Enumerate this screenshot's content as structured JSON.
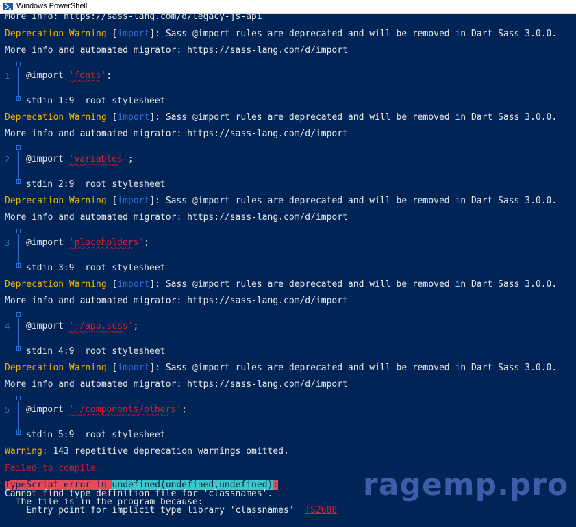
{
  "window": {
    "title": "Windows PowerShell"
  },
  "colors": {
    "background": "#012456",
    "warning": "#eeb200",
    "category": "#2b6fd6",
    "string": "#d91f2e",
    "error_bg": "#e64a5a",
    "undefined_bg": "#3fc6c6"
  },
  "console": {
    "line_more_info_legacy": "More info: https://sass-lang.com/d/legacy-js-api",
    "warning_label": "Deprecation Warning",
    "bracket_open": " [",
    "warning_category": "import",
    "warning_tail": "]: Sass @import rules are deprecated and will be removed in Dart Sass 3.0.0.",
    "more_info_import": "More info and automated migrator: https://sass-lang.com/d/import",
    "imports": [
      {
        "num": "1",
        "keyword": "@import ",
        "string": "'fonts'",
        "semi": ";",
        "caret": "^^^^^^^",
        "location": "stdin 1:9  root stylesheet"
      },
      {
        "num": "2",
        "keyword": "@import ",
        "string": "'variables'",
        "semi": ";",
        "caret": "^^^^^^^^^^^",
        "location": "stdin 2:9  root stylesheet"
      },
      {
        "num": "3",
        "keyword": "@import ",
        "string": "'placeholders'",
        "semi": ";",
        "caret": "^^^^^^^^^^^^^^",
        "location": "stdin 3:9  root stylesheet"
      },
      {
        "num": "4",
        "keyword": "@import ",
        "string": "'./app.scss'",
        "semi": ";",
        "caret": "^^^^^^^^^^^^",
        "location": "stdin 4:9  root stylesheet"
      },
      {
        "num": "5",
        "keyword": "@import ",
        "string": "'./components/others'",
        "semi": ";",
        "caret": "^^^^^^^^^^^^^^^^^^^^^^",
        "location": "stdin 5:9  root stylesheet"
      }
    ],
    "warning_omitted_label": "Warning:",
    "warning_omitted_text": " 143 repetitive deprecation warnings omitted.",
    "failed": "Failed to compile.",
    "ts_error_label": "TypeScript error in ",
    "ts_error_loc": "undefined(undefined,undefined)",
    "ts_error_colon": ":",
    "cannot_find": "Cannot find type definition file for 'classnames'.",
    "file_in_program": "  The file is in the program because:",
    "entry_point": "    Entry point for implicit type library 'classnames'  ",
    "ts_code": "TS2688"
  },
  "watermark": "ragemp.pro"
}
